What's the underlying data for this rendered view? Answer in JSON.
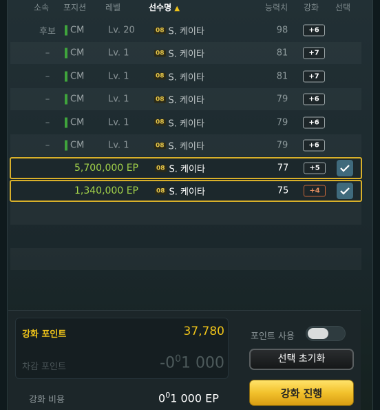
{
  "header": {
    "affiliation": "소속",
    "position": "포지션",
    "level": "레벨",
    "player_name": "선수명",
    "sort_arrow": "▲",
    "ovr": "능력치",
    "upgrade": "강화",
    "select": "선택"
  },
  "players": [
    {
      "affiliation": "후보",
      "position": "CM",
      "level": "Lv. 20",
      "season": "08",
      "name": "S. 케이타",
      "ovr": "98",
      "upgrade": "+6"
    },
    {
      "affiliation": "–",
      "position": "CM",
      "level": "Lv. 1",
      "season": "08",
      "name": "S. 케이타",
      "ovr": "81",
      "upgrade": "+7"
    },
    {
      "affiliation": "–",
      "position": "CM",
      "level": "Lv. 1",
      "season": "08",
      "name": "S. 케이타",
      "ovr": "81",
      "upgrade": "+7"
    },
    {
      "affiliation": "–",
      "position": "CM",
      "level": "Lv. 1",
      "season": "08",
      "name": "S. 케이타",
      "ovr": "79",
      "upgrade": "+6"
    },
    {
      "affiliation": "–",
      "position": "CM",
      "level": "Lv. 1",
      "season": "08",
      "name": "S. 케이타",
      "ovr": "79",
      "upgrade": "+6"
    },
    {
      "affiliation": "–",
      "position": "CM",
      "level": "Lv. 1",
      "season": "08",
      "name": "S. 케이타",
      "ovr": "79",
      "upgrade": "+6"
    }
  ],
  "selected": [
    {
      "ep": "5,700,000 EP",
      "season": "08",
      "name": "S. 케이타",
      "ovr": "77",
      "upgrade": "+5"
    },
    {
      "ep": "1,340,000 EP",
      "season": "08",
      "name": "S. 케이타",
      "ovr": "75",
      "upgrade": "+4"
    }
  ],
  "summary": {
    "points_label": "강화 포인트",
    "points_value": "37,780",
    "deduct_label": "차감 포인트",
    "deduct_prefix": "-0",
    "deduct_sup": "0",
    "deduct_rest": "1 000",
    "cost_label": "강화 비용",
    "cost_prefix": "0",
    "cost_sup": "0",
    "cost_rest": "1 000 EP",
    "use_points_label": "포인트 사용",
    "reset_button": "선택 초기화",
    "proceed_button": "강화 진행"
  },
  "colors": {
    "accent_gold": "#f0c419",
    "ep_green": "#a3d34a",
    "position_green": "#3fa43c",
    "check_blue": "#3f6a7c"
  }
}
